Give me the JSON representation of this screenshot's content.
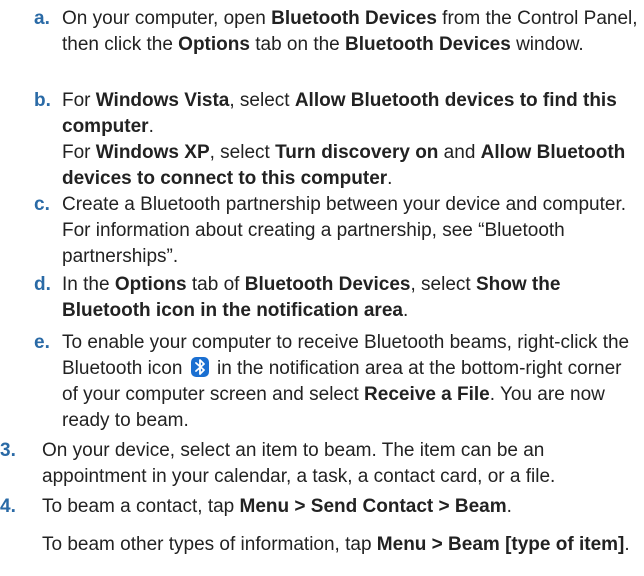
{
  "sub_steps": [
    {
      "marker": "a.",
      "parts": [
        {
          "t": "On your computer, open "
        },
        {
          "b": "Bluetooth Devices"
        },
        {
          "t": " from the Control Panel, then click the "
        },
        {
          "b": "Options"
        },
        {
          "t": " tab on the "
        },
        {
          "b": "Bluetooth Devices"
        },
        {
          "t": " window."
        }
      ]
    },
    {
      "marker": "b.",
      "parts": [
        {
          "t": "For "
        },
        {
          "b": "Windows Vista"
        },
        {
          "t": ", select "
        },
        {
          "b": "Allow Bluetooth devices to find this computer"
        },
        {
          "t": "."
        }
      ],
      "parts2": [
        {
          "t": "For "
        },
        {
          "b": "Windows XP"
        },
        {
          "t": ", select "
        },
        {
          "b": "Turn discovery on"
        },
        {
          "t": " and "
        },
        {
          "b": "Allow Bluetooth devices to connect to this computer"
        },
        {
          "t": "."
        }
      ]
    },
    {
      "marker": "c.",
      "parts": [
        {
          "t": "Create a Bluetooth partnership between your device and computer. For information about creating a partnership, see “Bluetooth partnerships”."
        }
      ]
    },
    {
      "marker": "d.",
      "parts": [
        {
          "t": "In the "
        },
        {
          "b": "Options"
        },
        {
          "t": " tab of "
        },
        {
          "b": "Bluetooth Devices"
        },
        {
          "t": ", select "
        },
        {
          "b": "Show the Bluetooth icon in the notification area"
        },
        {
          "t": "."
        }
      ]
    },
    {
      "marker": "e.",
      "parts": [
        {
          "t": "To enable your computer to receive Bluetooth beams, right-click the Bluetooth icon"
        },
        {
          "icon": "bluetooth-icon"
        },
        {
          "t": "in the notification area at the bottom-right corner of your computer screen and select "
        },
        {
          "b": "Receive a File"
        },
        {
          "t": ". You are now ready to beam."
        }
      ]
    }
  ],
  "steps": [
    {
      "marker": "3.",
      "parts": [
        {
          "t": "On your device, select an item to beam. The item can be an appointment in your calendar, a task, a contact card, or a file."
        }
      ]
    },
    {
      "marker": "4.",
      "parts": [
        {
          "t": "To beam a contact, tap "
        },
        {
          "b": "Menu > Send Contact > Beam"
        },
        {
          "t": "."
        }
      ],
      "parts2": [
        {
          "t": "To beam other types of information, tap "
        },
        {
          "b": "Menu > Beam [type of item]"
        },
        {
          "t": "."
        }
      ]
    }
  ],
  "colors": {
    "marker": "#2a6aa6",
    "text": "#222222",
    "bluetooth_icon_bg": "#1a6fd1"
  }
}
